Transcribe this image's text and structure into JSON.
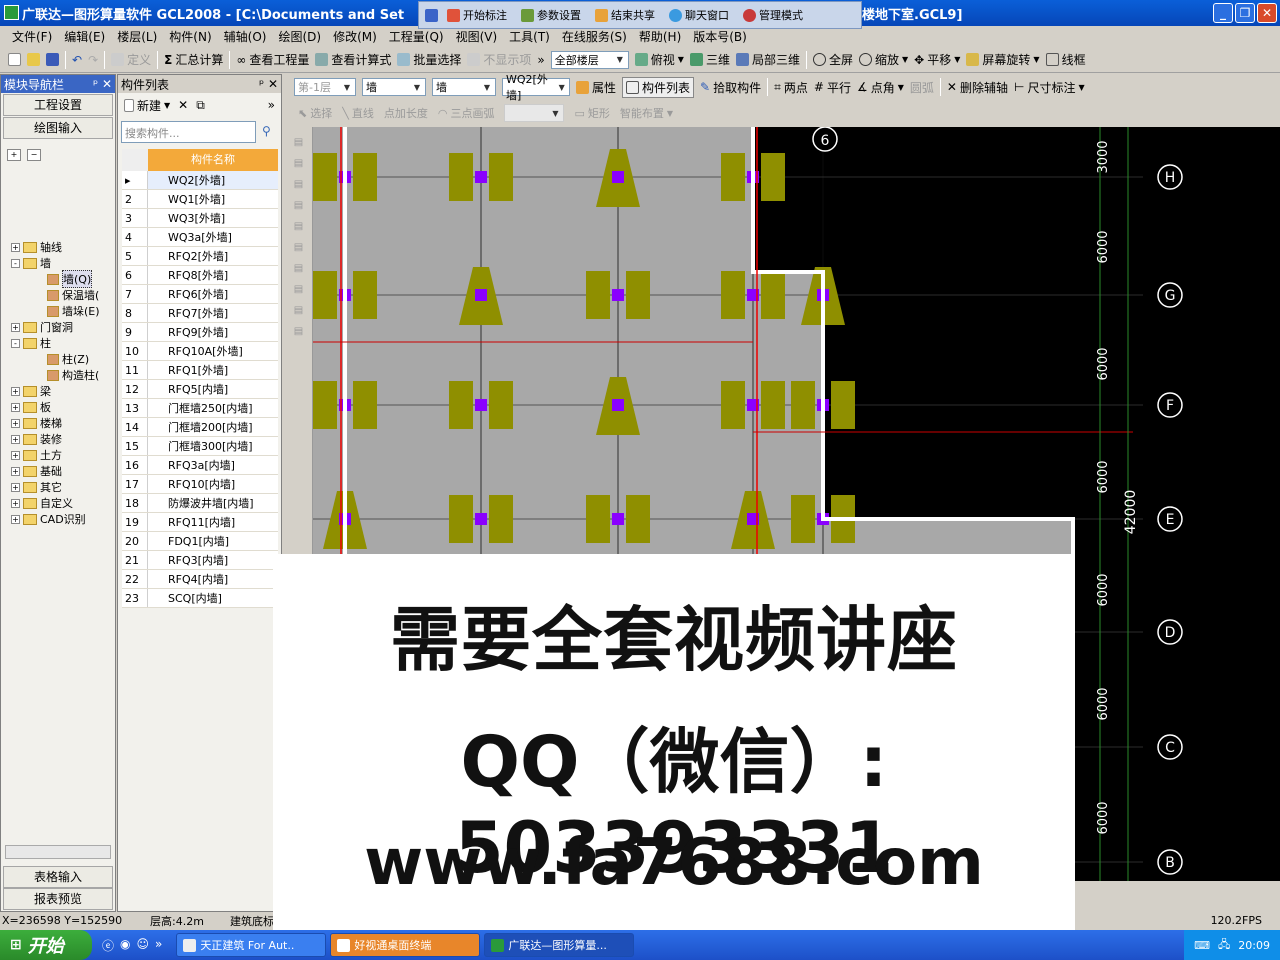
{
  "window": {
    "title": "广联达—图形算量软件 GCL2008 - [C:\\Documents and Set",
    "title_tail": "楼地下室.GCL9]"
  },
  "collab": [
    "开始标注",
    "参数设置",
    "结束共享",
    "聊天窗口",
    "管理模式"
  ],
  "menu": [
    "文件(F)",
    "编辑(E)",
    "楼层(L)",
    "构件(N)",
    "辅轴(O)",
    "绘图(D)",
    "修改(M)",
    "工程量(Q)",
    "视图(V)",
    "工具(T)",
    "在线服务(S)",
    "帮助(H)",
    "版本号(B)"
  ],
  "toolbar1": {
    "define": "定义",
    "summary": "汇总计算",
    "view_qty": "查看工程量",
    "view_formula": "查看计算式",
    "batch": "批量选择",
    "no_display": "不显示项",
    "floor_combo": "全部楼层",
    "top_view": "俯视",
    "three_d": "三维",
    "local_3d": "局部三维",
    "fullscreen": "全屏",
    "zoom": "缩放",
    "pan": "平移",
    "rotate": "屏幕旋转",
    "wireframe": "线框"
  },
  "toolbar2": {
    "layer": "第-1层",
    "type_combo": "墙",
    "sub_combo": "墙",
    "comp_combo": "WQ2[外墙]",
    "attr": "属性",
    "comp_list": "构件列表",
    "pick": "拾取构件",
    "two_pt": "两点",
    "parallel": "平行",
    "angle_pt": "点角",
    "arc": "圆弧",
    "del_aux": "删除辅轴",
    "dim": "尺寸标注"
  },
  "toolbar3": {
    "select": "选择",
    "straight": "直线",
    "pt_len": "点加长度",
    "three_pt_arc": "三点画弧",
    "rect": "矩形",
    "smart": "智能布置"
  },
  "left_panel": {
    "title": "模块导航栏",
    "project_settings": "工程设置",
    "draw_input": "绘图输入",
    "table_input": "表格输入",
    "report": "报表预览",
    "tree": [
      {
        "label": "轴线",
        "lvl": 0,
        "exp": "+"
      },
      {
        "label": "墙",
        "lvl": 0,
        "exp": "-"
      },
      {
        "label": "墙(Q)",
        "lvl": 1
      },
      {
        "label": "保温墙(",
        "lvl": 1
      },
      {
        "label": "墙垛(E)",
        "lvl": 1
      },
      {
        "label": "门窗洞",
        "lvl": 0,
        "exp": "+"
      },
      {
        "label": "柱",
        "lvl": 0,
        "exp": "-"
      },
      {
        "label": "柱(Z)",
        "lvl": 1
      },
      {
        "label": "构造柱(",
        "lvl": 1
      },
      {
        "label": "梁",
        "lvl": 0,
        "exp": "+"
      },
      {
        "label": "板",
        "lvl": 0,
        "exp": "+"
      },
      {
        "label": "楼梯",
        "lvl": 0,
        "exp": "+"
      },
      {
        "label": "装修",
        "lvl": 0,
        "exp": "+"
      },
      {
        "label": "土方",
        "lvl": 0,
        "exp": "+"
      },
      {
        "label": "基础",
        "lvl": 0,
        "exp": "+"
      },
      {
        "label": "其它",
        "lvl": 0,
        "exp": "+"
      },
      {
        "label": "自定义",
        "lvl": 0,
        "exp": "+"
      },
      {
        "label": "CAD识别",
        "lvl": 0,
        "exp": "+"
      }
    ]
  },
  "comp_panel": {
    "title": "构件列表",
    "new": "新建",
    "search_placeholder": "搜索构件...",
    "col_name": "构件名称",
    "rows": [
      "WQ2[外墙]",
      "WQ1[外墙]",
      "WQ3[外墙]",
      "WQ3a[外墙]",
      "RFQ2[外墙]",
      "RFQ8[外墙]",
      "RFQ6[外墙]",
      "RFQ7[外墙]",
      "RFQ9[外墙]",
      "RFQ10A[外墙]",
      "RFQ1[外墙]",
      "RFQ5[内墙]",
      "门框墙250[内墙]",
      "门框墙200[内墙]",
      "门框墙300[内墙]",
      "RFQ3a[内墙]",
      "RFQ10[内墙]",
      "防爆波井墙[内墙]",
      "RFQ11[内墙]",
      "FDQ1[内墙]",
      "RFQ3[内墙]",
      "RFQ4[内墙]",
      "SCQ[内墙]"
    ]
  },
  "canvas": {
    "axes_right": [
      "H",
      "G",
      "F",
      "E",
      "D",
      "C",
      "B"
    ],
    "dims": [
      "3000",
      "6000",
      "6000",
      "6000",
      "6000",
      "6000",
      "6000"
    ],
    "total": "42000",
    "col_label": "6"
  },
  "status": {
    "coords": "X=236598 Y=152590",
    "floor_height": "层高:4.2m",
    "base": "建筑底标",
    "fps": "120.2FPS"
  },
  "taskbar": {
    "start": "开始",
    "tasks": [
      "天正建筑 For Aut..",
      "好视通桌面终端",
      "广联达—图形算量..."
    ],
    "time": "20:09"
  },
  "overlay": {
    "line1": "需要全套视频讲座",
    "line2": "QQ（微信）: 503393331",
    "line3": "www.fa7688.com"
  }
}
